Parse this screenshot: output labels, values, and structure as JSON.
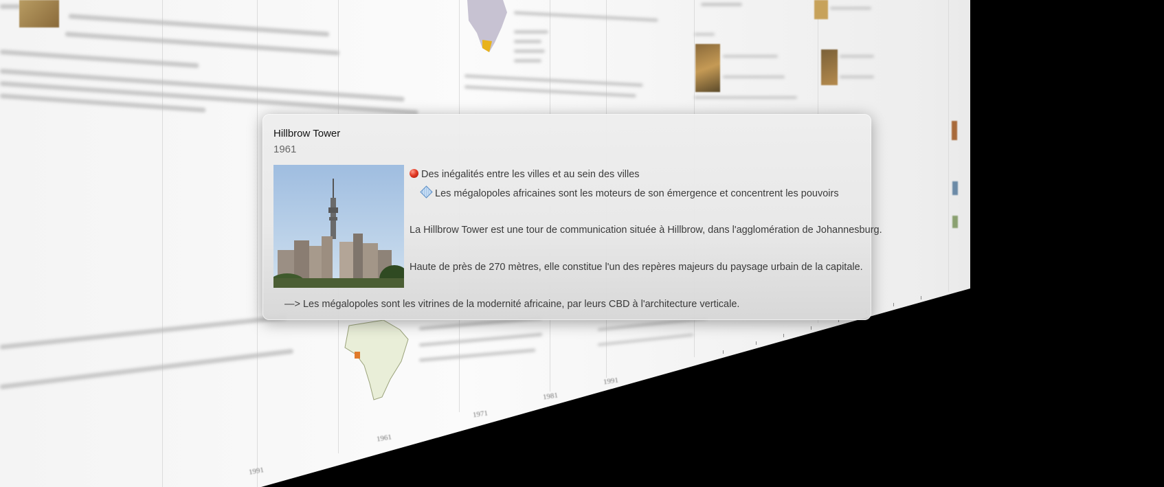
{
  "popup": {
    "title": "Hillbrow Tower",
    "date": "1961",
    "image_alt": "Hillbrow Tower skyline photo",
    "tag_primary": "Des inégalités entre les villes et au sein des villes",
    "tag_secondary": "Les mégalopoles africaines sont les moteurs de son émergence et concentrent les pouvoirs",
    "paragraph_1": "La Hillbrow Tower est une tour de communication située à Hillbrow, dans l'agglomération de Johannesburg.",
    "paragraph_2": "Haute de près de 270 mètres, elle constitue l'un des repères majeurs du paysage urbain de la capitale.",
    "conclusion": "—> Les mégalopoles sont les vitrines de la modernité africaine, par leurs CBD à l'architecture verticale."
  },
  "timeline": {
    "axis_labels": [
      "1991",
      "1961",
      "1971",
      "1981",
      "1991"
    ]
  },
  "colors": {
    "popup_bg": "#e9e9e9",
    "tag_primary_dot": "#e23a25",
    "tag_secondary_icon": "#5b8fc7",
    "background": "#000000"
  },
  "icons": {
    "tag_primary": "red-dot-icon",
    "tag_secondary": "blue-diamond-icon"
  }
}
